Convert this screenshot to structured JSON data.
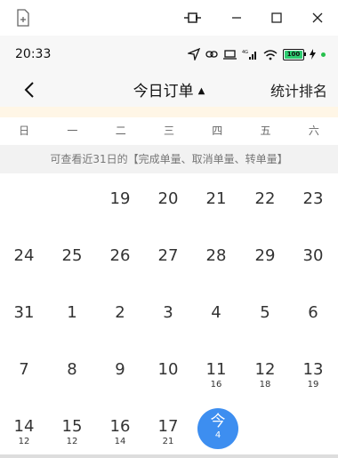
{
  "window": {
    "new_window_icon": "new-window-icon",
    "pin_icon": "pin-icon",
    "minimize_icon": "minimize-icon",
    "maximize_icon": "maximize-icon",
    "close_icon": "close-icon"
  },
  "status_bar": {
    "time": "20:33",
    "battery": "100",
    "network": "4G"
  },
  "header": {
    "title": "今日订单",
    "title_caret": "▲",
    "right_label": "统计排名"
  },
  "weekdays": [
    "日",
    "一",
    "二",
    "三",
    "四",
    "五",
    "六"
  ],
  "info_banner": "可查看近31日的【完成单量、取消单量、转单量】",
  "calendar": {
    "row1": [
      {
        "day": "19",
        "count": ""
      },
      {
        "day": "20",
        "count": ""
      },
      {
        "day": "21",
        "count": ""
      },
      {
        "day": "22",
        "count": ""
      },
      {
        "day": "23",
        "count": ""
      }
    ],
    "row2": [
      {
        "day": "24",
        "count": ""
      },
      {
        "day": "25",
        "count": ""
      },
      {
        "day": "26",
        "count": ""
      },
      {
        "day": "27",
        "count": ""
      },
      {
        "day": "28",
        "count": ""
      },
      {
        "day": "29",
        "count": ""
      },
      {
        "day": "30",
        "count": ""
      }
    ],
    "row3": [
      {
        "day": "31",
        "count": ""
      },
      {
        "day": "1",
        "count": ""
      },
      {
        "day": "2",
        "count": ""
      },
      {
        "day": "3",
        "count": ""
      },
      {
        "day": "4",
        "count": ""
      },
      {
        "day": "5",
        "count": ""
      },
      {
        "day": "6",
        "count": ""
      }
    ],
    "row4": [
      {
        "day": "7",
        "count": ""
      },
      {
        "day": "8",
        "count": ""
      },
      {
        "day": "9",
        "count": ""
      },
      {
        "day": "10",
        "count": ""
      },
      {
        "day": "11",
        "count": "16"
      },
      {
        "day": "12",
        "count": "18"
      },
      {
        "day": "13",
        "count": "19"
      }
    ],
    "row5": [
      {
        "day": "14",
        "count": "12"
      },
      {
        "day": "15",
        "count": "12"
      },
      {
        "day": "16",
        "count": "14"
      },
      {
        "day": "17",
        "count": "21"
      }
    ],
    "today": {
      "label": "今",
      "count": "4"
    }
  },
  "colors": {
    "today_accent": "#3d8ef0",
    "notice_bg": "#fff6e6",
    "banner_bg": "#f2f2f2"
  }
}
